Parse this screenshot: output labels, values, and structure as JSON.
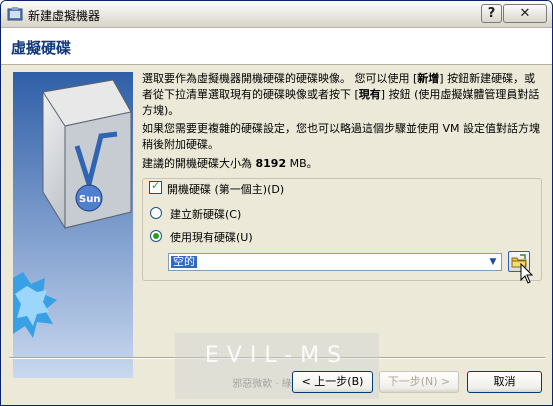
{
  "window": {
    "title": "新建虛擬機器",
    "help_icon": "?",
    "close_icon": "✕"
  },
  "header": {
    "title": "虛擬硬碟"
  },
  "body": {
    "para1_a": "選取要作為虛擬機器開機硬碟的硬碟映像。 您可以使用 [",
    "para1_b": "新增",
    "para1_c": "] 按鈕新建硬碟，或者從下拉清單選取現有的硬碟映像或者按下 [",
    "para1_d": "現有",
    "para1_e": "] 按鈕 (使用虛擬媒體管理員對話方塊)。",
    "para2": "如果您需要更複雜的硬碟設定，您也可以略過這個步驟並使用 VM 設定值對話方塊稍後附加硬碟。",
    "para3_a": "建議的開機硬碟大小為 ",
    "para3_b": "8192",
    "para3_c": " MB。"
  },
  "group": {
    "checkbox_label": "開機硬碟 (第一個主)(D)",
    "checkbox_checked": true,
    "radio_new_label": "建立新硬碟(C)",
    "radio_existing_label": "使用現有硬碟(U)",
    "selected_option": "existing",
    "combo_value": "空的"
  },
  "buttons": {
    "back": "< 上一步(B)",
    "next": "下一步(N) >",
    "cancel": "取消"
  },
  "watermark": {
    "line1": "EVIL-MS",
    "line2": "邪惡微軟 · 綠色軟體"
  },
  "colors": {
    "title_blue": "#10387a",
    "selection": "#316ac5"
  }
}
